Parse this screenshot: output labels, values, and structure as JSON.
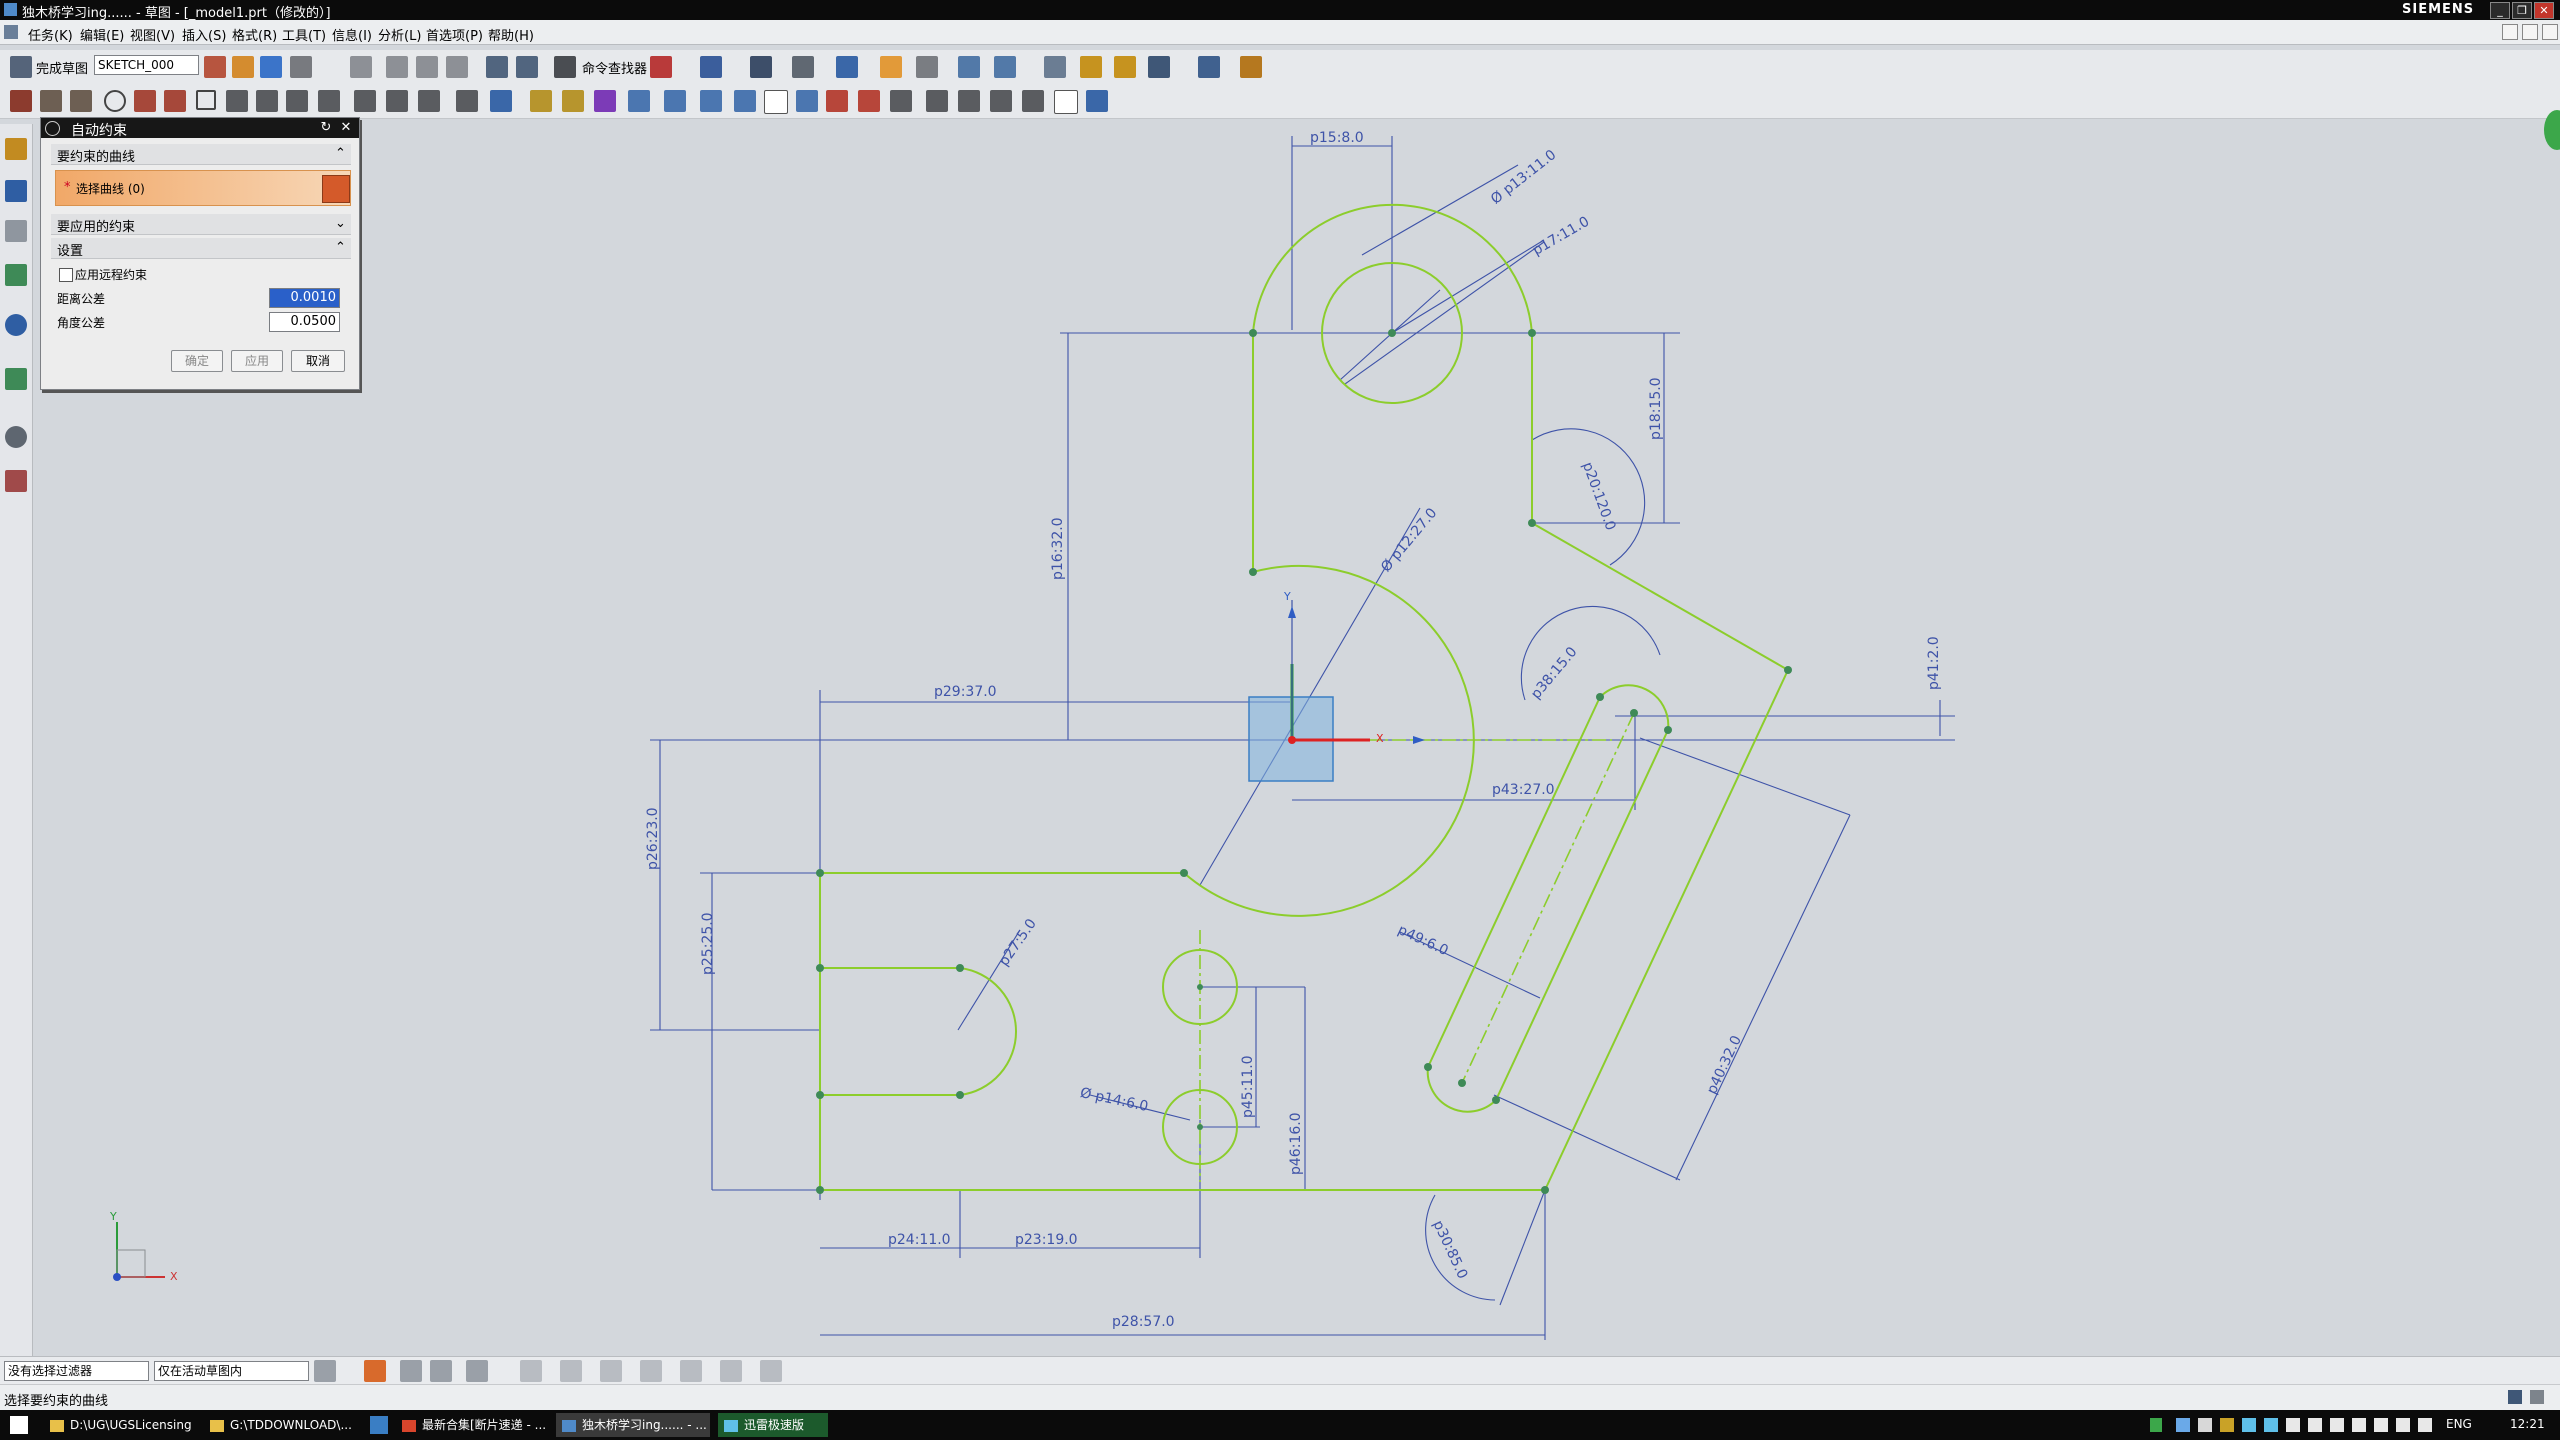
{
  "window": {
    "title": "独木桥学习ing...... - 草图 - [_model1.prt（修改的）]",
    "brand": "SIEMENS"
  },
  "menu": [
    "任务(K)",
    "编辑(E)",
    "视图(V)",
    "插入(S)",
    "格式(R)",
    "工具(T)",
    "信息(I)",
    "分析(L)",
    "首选项(P)",
    "帮助(H)"
  ],
  "toolbar": {
    "finish_sketch": "完成草图",
    "sketch_name": "SKETCH_000",
    "command_finder": "命令查找器"
  },
  "dialog": {
    "title": "自动约束",
    "section_curves": "要约束的曲线",
    "select_curves": "选择曲线 (0)",
    "section_constraints": "要应用的约束",
    "section_settings": "设置",
    "apply_remote": "应用远程约束",
    "distance_tol_label": "距离公差",
    "distance_tol_value": "0.0010",
    "angle_tol_label": "角度公差",
    "angle_tol_value": "0.0500",
    "ok": "确定",
    "apply": "应用",
    "cancel": "取消"
  },
  "dimensions": {
    "p15": "p15:8.0",
    "p13": "Ø p13:11.0",
    "p17": "p17:11.0",
    "p18": "p18:15.0",
    "p20": "p20:120.0",
    "p16": "p16:32.0",
    "p12": "Ø p12:27.0",
    "p29": "p29:37.0",
    "p38": "p38:15.0",
    "p41": "p41:2.0",
    "p43": "p43:27.0",
    "p26": "p26:23.0",
    "p25": "p25:25.0",
    "p27": "p27:5.0",
    "p14": "Ø p14:6.0",
    "p45": "p45:11.0",
    "p46": "p46:16.0",
    "p49": "p49:6.0",
    "p40": "p40:32.0",
    "p24": "p24:11.0",
    "p23": "p23:19.0",
    "p30": "p30:85.0",
    "p28": "p28:57.0"
  },
  "axis_labels": {
    "x": "X",
    "y": "Y"
  },
  "filter": {
    "type_filter": "没有选择过滤器",
    "scope": "仅在活动草图内"
  },
  "status_text": "选择要约束的曲线",
  "taskbar": {
    "items": [
      "D:\\UG\\UGSLicensing",
      "G:\\TDDOWNLOAD\\...",
      "最新合集[断片速递 - ...",
      "独木桥学习ing...... - ...",
      "迅雷极速版"
    ],
    "lang": "ENG",
    "time": "12:21"
  },
  "colors": {
    "curve": "#8ccd2c",
    "dimension": "#3e53a8",
    "point": "#3e8a57",
    "background": "#d3d7dc"
  }
}
